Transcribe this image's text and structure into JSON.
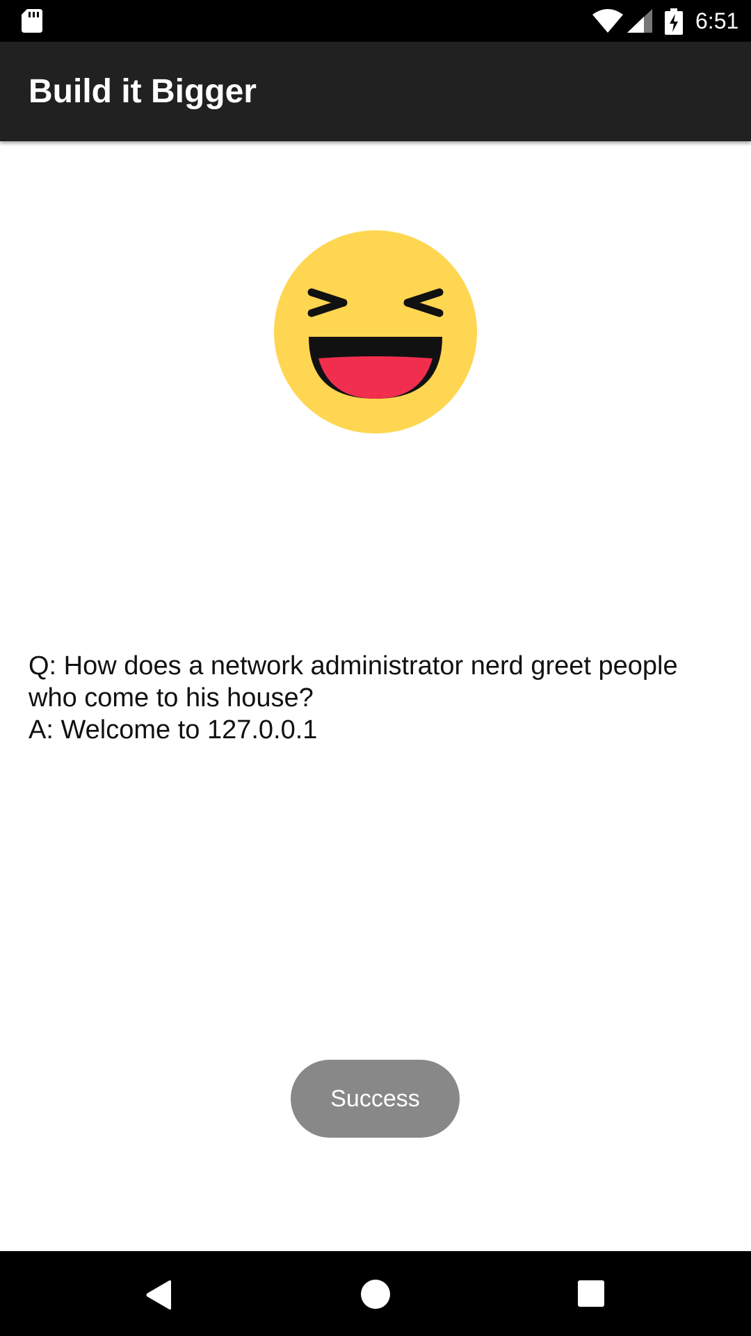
{
  "status_bar": {
    "time": "6:51",
    "icons": [
      "sd-card-icon",
      "wifi-icon",
      "cell-signal-icon",
      "battery-charging-icon"
    ]
  },
  "toolbar": {
    "title": "Build it Bigger"
  },
  "content": {
    "emoji": "laughing-emoji-icon",
    "joke_lines": [
      "Q: How does a network administrator nerd greet people",
      "who come to his house?",
      "A: Welcome to 127.0.0.1"
    ]
  },
  "toast": {
    "message": "Success"
  },
  "nav_bar": {
    "icons": [
      "back-icon",
      "home-icon",
      "recents-icon"
    ]
  },
  "colors": {
    "status_bar": "#000000",
    "toolbar": "#212121",
    "emoji_face": "#FFD651",
    "emoji_mouth": "#F22E4F",
    "toast": "#888888",
    "nav_bar": "#000000"
  }
}
